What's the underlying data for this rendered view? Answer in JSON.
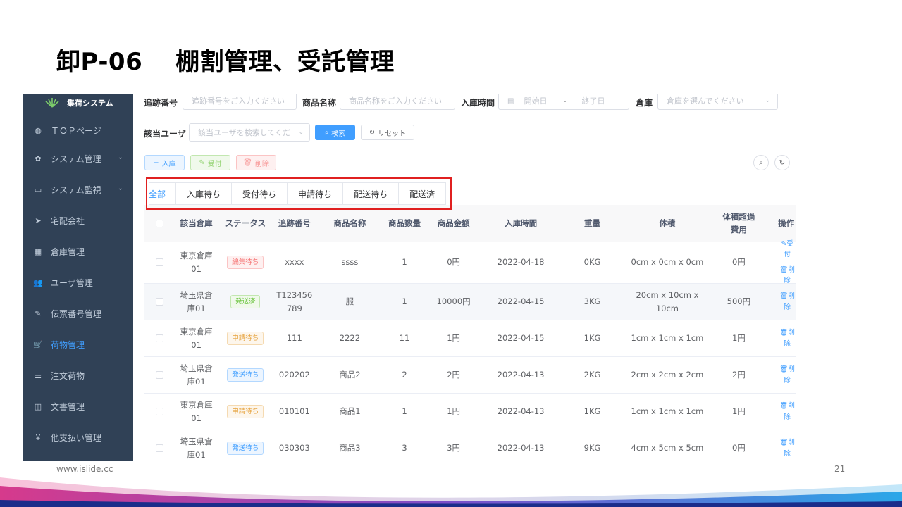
{
  "slide": {
    "title": "卸P-06　 棚割管理、受託管理",
    "url": "www.islide.cc",
    "page": "21"
  },
  "sidebar": {
    "brand": "集荷システム",
    "items": [
      {
        "label": "ＴＯＰページ",
        "icon": "dashboard-icon",
        "glyph": "◍",
        "chevron": false,
        "active": false
      },
      {
        "label": "システム管理",
        "icon": "gear-icon",
        "glyph": "✿",
        "chevron": true,
        "active": false
      },
      {
        "label": "システム監視",
        "icon": "monitor-icon",
        "glyph": "▭",
        "chevron": true,
        "active": false
      },
      {
        "label": "宅配会社",
        "icon": "send-icon",
        "glyph": "➤",
        "chevron": false,
        "active": false
      },
      {
        "label": "倉庫管理",
        "icon": "grid-icon",
        "glyph": "▦",
        "chevron": false,
        "active": false
      },
      {
        "label": "ユーザ管理",
        "icon": "user-icon",
        "glyph": "👥",
        "chevron": false,
        "active": false
      },
      {
        "label": "伝票番号管理",
        "icon": "edit-icon",
        "glyph": "✎",
        "chevron": false,
        "active": false
      },
      {
        "label": "荷物管理",
        "icon": "cart-icon",
        "glyph": "🛒",
        "chevron": false,
        "active": true
      },
      {
        "label": "注文荷物",
        "icon": "list-icon",
        "glyph": "☰",
        "chevron": false,
        "active": false
      },
      {
        "label": "文書管理",
        "icon": "book-icon",
        "glyph": "◫",
        "chevron": false,
        "active": false
      },
      {
        "label": "他支払い管理",
        "icon": "yen-icon",
        "glyph": "¥",
        "chevron": false,
        "active": false
      }
    ]
  },
  "filters": {
    "tracking_label": "追跡番号",
    "tracking_placeholder": "追跡番号をご入力ください",
    "product_label": "商品名称",
    "product_placeholder": "商品名称をご入力ください",
    "date_label": "入庫時間",
    "date_start": "開始日",
    "date_sep": "-",
    "date_end": "終了日",
    "warehouse_label": "倉庫",
    "warehouse_placeholder": "倉庫を選んでください",
    "user_label": "該当ユーザ",
    "user_placeholder": "該当ユーザを検索してくだ",
    "search_btn": "検索",
    "reset_btn": "リセット"
  },
  "toolbar": {
    "add": "入庫",
    "receive": "受付",
    "delete": "削除"
  },
  "tabs": [
    "全部",
    "入庫待ち",
    "受付待ち",
    "申請待ち",
    "配送待ち",
    "配送済"
  ],
  "table": {
    "headers": [
      "該当倉庫",
      "ステータス",
      "追跡番号",
      "商品名称",
      "商品数量",
      "商品金額",
      "入庫時間",
      "重量",
      "体積",
      "体積超過\n費用",
      "操作"
    ],
    "rows": [
      {
        "warehouse": "東京倉庫\n01",
        "status": "編集待ち",
        "tracking": "xxxx",
        "product": "ssss",
        "qty": "1",
        "amount": "0円",
        "date": "2022-04-18",
        "weight": "0KG",
        "volume": "0cm x 0cm x 0cm",
        "extra": "0円",
        "ops": [
          "受付",
          "削除"
        ]
      },
      {
        "warehouse": "埼玉県倉\n庫01",
        "status": "発送済",
        "tracking": "T123456\n789",
        "product": "服",
        "qty": "1",
        "amount": "10000円",
        "date": "2022-04-15",
        "weight": "3KG",
        "volume": "20cm x 10cm x 10cm",
        "extra": "500円",
        "ops": [
          "削除"
        ]
      },
      {
        "warehouse": "東京倉庫\n01",
        "status": "申請待ち",
        "tracking": "111",
        "product": "2222",
        "qty": "11",
        "amount": "1円",
        "date": "2022-04-15",
        "weight": "1KG",
        "volume": "1cm x 1cm x 1cm",
        "extra": "1円",
        "ops": [
          "削除"
        ]
      },
      {
        "warehouse": "埼玉県倉\n庫01",
        "status": "発送待ち",
        "tracking": "020202",
        "product": "商品2",
        "qty": "2",
        "amount": "2円",
        "date": "2022-04-13",
        "weight": "2KG",
        "volume": "2cm x 2cm x 2cm",
        "extra": "2円",
        "ops": [
          "削除"
        ]
      },
      {
        "warehouse": "東京倉庫\n01",
        "status": "申請待ち",
        "tracking": "010101",
        "product": "商品1",
        "qty": "1",
        "amount": "1円",
        "date": "2022-04-13",
        "weight": "1KG",
        "volume": "1cm x 1cm x 1cm",
        "extra": "1円",
        "ops": [
          "削除"
        ]
      },
      {
        "warehouse": "埼玉県倉\n庫01",
        "status": "発送待ち",
        "tracking": "030303",
        "product": "商品3",
        "qty": "3",
        "amount": "3円",
        "date": "2022-04-13",
        "weight": "9KG",
        "volume": "4cm x 5cm x 5cm",
        "extra": "0円",
        "ops": [
          "削除"
        ]
      }
    ]
  },
  "status_colors": {
    "編集待ち": {
      "fg": "#f56c6c",
      "bg": "#fef0f0",
      "bd": "#fbc4c4"
    },
    "発送済": {
      "fg": "#67c23a",
      "bg": "#f0f9eb",
      "bd": "#c2e7b0"
    },
    "申請待ち": {
      "fg": "#e6a23c",
      "bg": "#fdf6ec",
      "bd": "#f5dab1"
    },
    "発送待ち": {
      "fg": "#409eff",
      "bg": "#ecf5ff",
      "bd": "#b3d8ff"
    }
  }
}
